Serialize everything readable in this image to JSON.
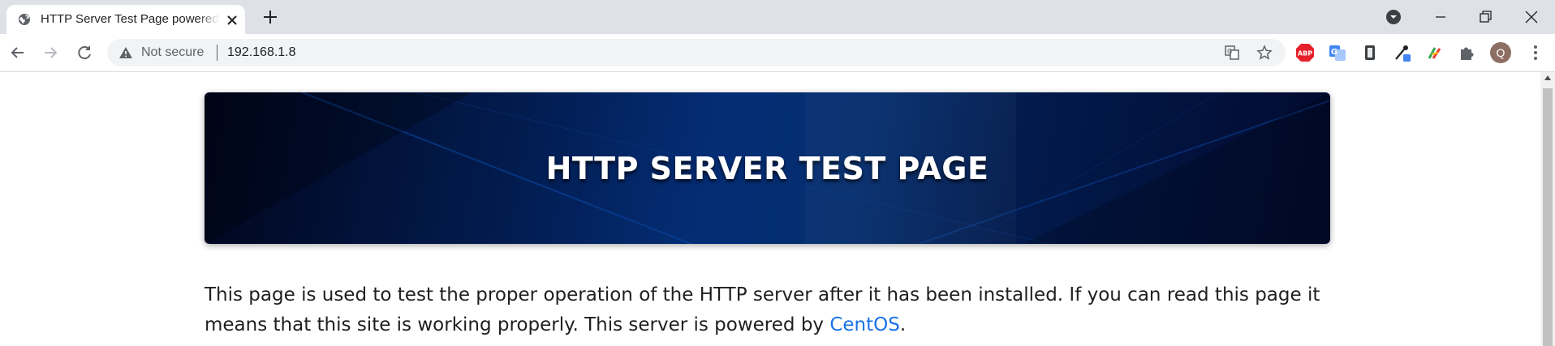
{
  "tab": {
    "title": "HTTP Server Test Page powered by CentOS"
  },
  "address_bar": {
    "security_label": "Not secure",
    "url": "192.168.1.8"
  },
  "profile": {
    "initial": "Q"
  },
  "extensions": {
    "adblock_label": "ABP"
  },
  "page": {
    "hero_title": "HTTP SERVER TEST PAGE",
    "paragraph_text": "This page is used to test the proper operation of the HTTP server after it has been installed. If you can read this page it means that this site is working properly. This server is powered by ",
    "link_text": "CentOS",
    "paragraph_end": "."
  },
  "colors": {
    "tabstrip_bg": "#dee1e6",
    "link": "#1a73e8",
    "hero_dark": "#01051d",
    "hero_blue": "#042d75"
  }
}
